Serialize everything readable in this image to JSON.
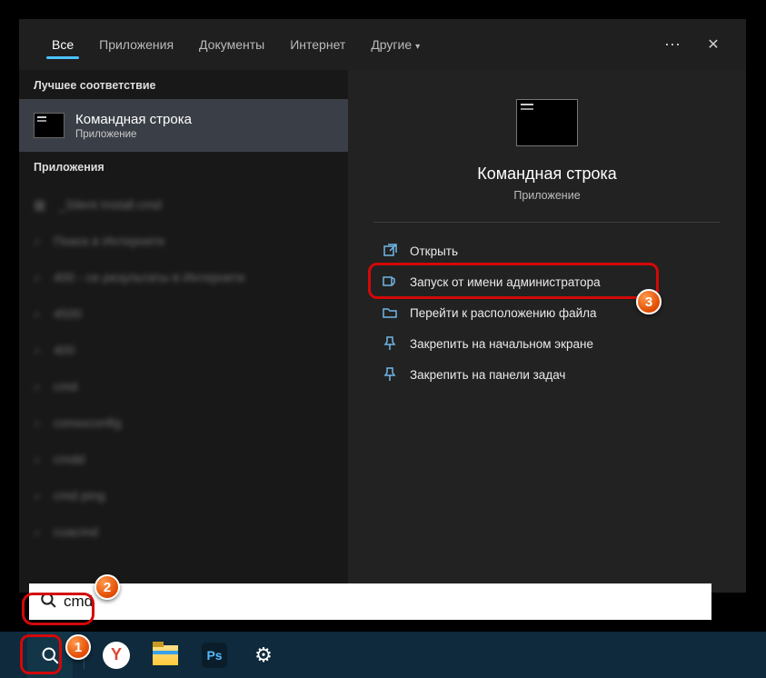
{
  "tabs": {
    "all": "Все",
    "apps": "Приложения",
    "docs": "Документы",
    "internet": "Интернет",
    "other": "Другие"
  },
  "left": {
    "best_match_header": "Лучшее соответствие",
    "best": {
      "title": "Командная строка",
      "sub": "Приложение"
    },
    "apps_header": "Приложения",
    "items": [
      "_Silent Install.cmd",
      "Поиск в Интернете",
      "400 - се результаты в Интернете",
      "4500",
      "400",
      "cmd",
      "consoconfig",
      "cmdd",
      "cmd ping",
      "cuacmd"
    ]
  },
  "right": {
    "title": "Командная строка",
    "sub": "Приложение",
    "actions": {
      "open": "Открыть",
      "run_admin": "Запуск от имени администратора",
      "open_location": "Перейти к расположению файла",
      "pin_start": "Закрепить на начальном экране",
      "pin_taskbar": "Закрепить на панели задач"
    }
  },
  "search": {
    "value": "cmd"
  },
  "markers": {
    "m1": "1",
    "m2": "2",
    "m3": "3"
  },
  "taskbar": {
    "y_label": "Y",
    "ps_label": "Ps"
  }
}
